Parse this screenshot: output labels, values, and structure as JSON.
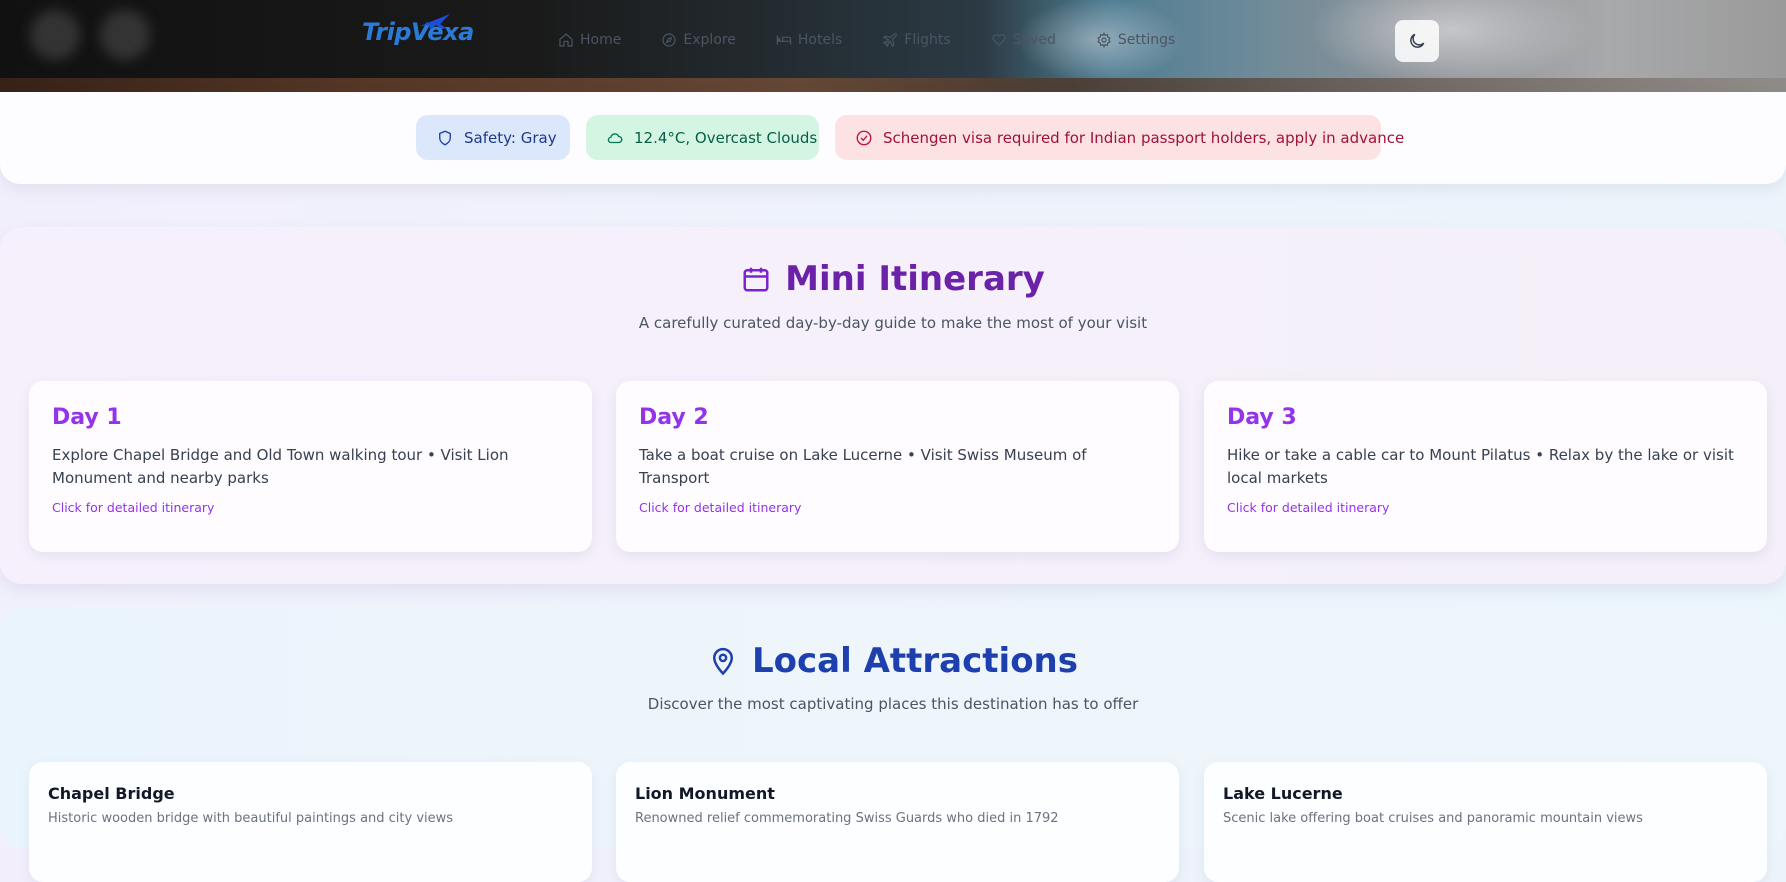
{
  "header": {
    "logo": "TripVexa",
    "nav": [
      {
        "label": "Home",
        "icon": "home-icon"
      },
      {
        "label": "Explore",
        "icon": "compass-icon"
      },
      {
        "label": "Hotels",
        "icon": "bed-icon"
      },
      {
        "label": "Flights",
        "icon": "plane-icon"
      },
      {
        "label": "Saved",
        "icon": "heart-icon"
      },
      {
        "label": "Settings",
        "icon": "gear-icon"
      }
    ],
    "theme_toggle_icon": "moon-icon"
  },
  "info_badges": {
    "safety": "Safety: Gray",
    "weather": "12.4°C, Overcast Clouds",
    "visa": "Schengen visa required for Indian passport holders, apply in advance"
  },
  "itinerary": {
    "title": "Mini Itinerary",
    "subtitle": "A carefully curated day-by-day guide to make the most of your visit",
    "days": [
      {
        "title": "Day 1",
        "desc": "Explore Chapel Bridge and Old Town walking tour • Visit Lion Monument and nearby parks",
        "link": "Click for detailed itinerary"
      },
      {
        "title": "Day 2",
        "desc": "Take a boat cruise on Lake Lucerne • Visit Swiss Museum of Transport",
        "link": "Click for detailed itinerary"
      },
      {
        "title": "Day 3",
        "desc": "Hike or take a cable car to Mount Pilatus • Relax by the lake or visit local markets",
        "link": "Click for detailed itinerary"
      }
    ]
  },
  "attractions": {
    "title": "Local Attractions",
    "subtitle": "Discover the most captivating places this destination has to offer",
    "items": [
      {
        "name": "Chapel Bridge",
        "desc": "Historic wooden bridge with beautiful paintings and city views"
      },
      {
        "name": "Lion Monument",
        "desc": "Renowned relief commemorating Swiss Guards who died in 1792"
      },
      {
        "name": "Lake Lucerne",
        "desc": "Scenic lake offering boat cruises and panoramic mountain views"
      }
    ]
  },
  "colors": {
    "accent_purple": "#9333ea",
    "accent_blue": "#1e40af",
    "safety_bg": "#dbe7fb",
    "weather_bg": "#d5f5e3",
    "visa_bg": "#fde2e4"
  }
}
